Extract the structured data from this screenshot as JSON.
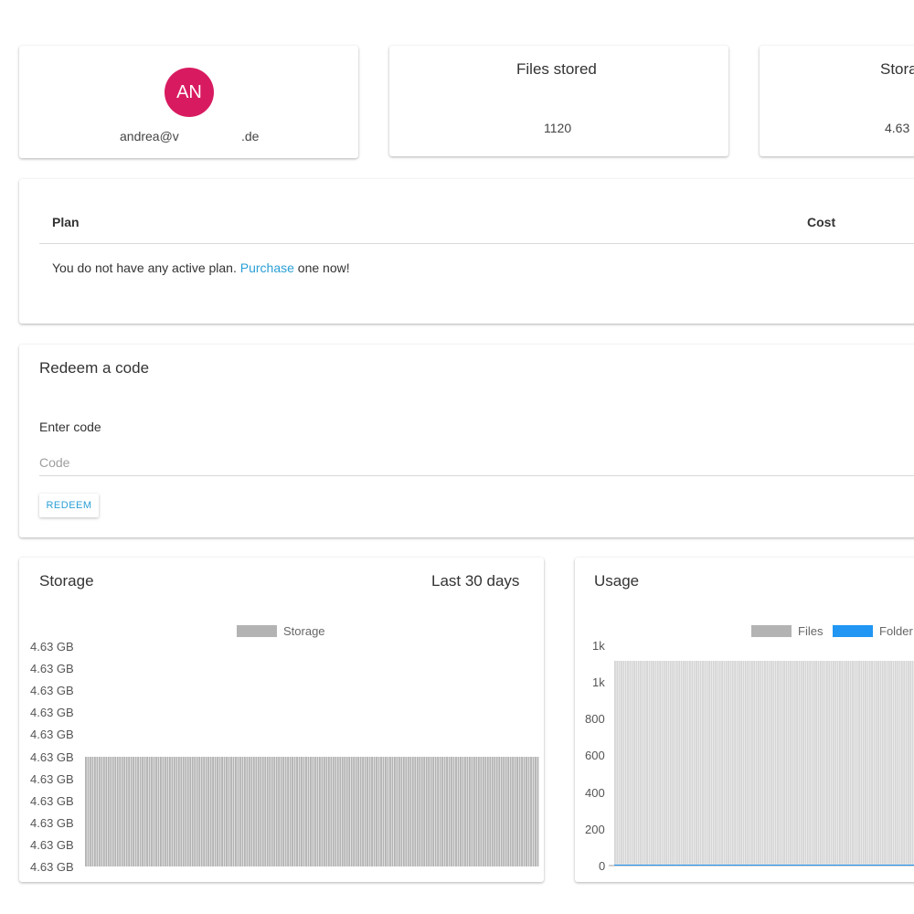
{
  "profile": {
    "avatar_initials": "AN",
    "avatar_color": "#d81b60",
    "email_start": "andrea@v",
    "email_end": ".de"
  },
  "files_stat": {
    "title": "Files stored",
    "value": "1120"
  },
  "storage_stat": {
    "title": "Stora",
    "value": "4.63"
  },
  "plan": {
    "col_plan": "Plan",
    "col_cost": "Cost",
    "message_before": "You do not have any active plan. ",
    "message_link": "Purchase",
    "message_after": " one now!"
  },
  "redeem": {
    "title": "Redeem a code",
    "label": "Enter code",
    "placeholder": "Code",
    "value": "",
    "button": "REDEEM"
  },
  "storage_chart": {
    "title": "Storage",
    "range_label": "Last 30 days"
  },
  "usage_chart": {
    "title": "Usage"
  },
  "colors": {
    "accent": "#2a9fd6",
    "bar_gray": "#b3b3b3",
    "folders_blue": "#2196f3"
  },
  "chart_data": [
    {
      "type": "bar",
      "title": "Storage",
      "legend": [
        "Storage"
      ],
      "legend_position": "top",
      "y_tick_labels": [
        "4.63 GB",
        "4.63 GB",
        "4.63 GB",
        "4.63 GB",
        "4.63 GB",
        "4.63 GB",
        "4.63 GB",
        "4.63 GB",
        "4.63 GB",
        "4.63 GB",
        "4.63 GB"
      ],
      "series": [
        {
          "name": "Storage",
          "color": "#b3b3b3",
          "bar_count": 200,
          "values_gb_fraction_of_axis": 0.5
        }
      ]
    },
    {
      "type": "bar",
      "title": "Usage",
      "legend": [
        "Files",
        "Folder"
      ],
      "legend_position": "top",
      "y_tick_labels": [
        "0",
        "200",
        "400",
        "600",
        "800",
        "1k",
        "1k"
      ],
      "ylim": [
        0,
        1200
      ],
      "series": [
        {
          "name": "Files",
          "color": "#b3b3b3",
          "bar_count": 140,
          "value": 1120
        },
        {
          "name": "Folder",
          "color": "#2196f3",
          "bar_count": 140,
          "value": 0
        }
      ]
    }
  ]
}
